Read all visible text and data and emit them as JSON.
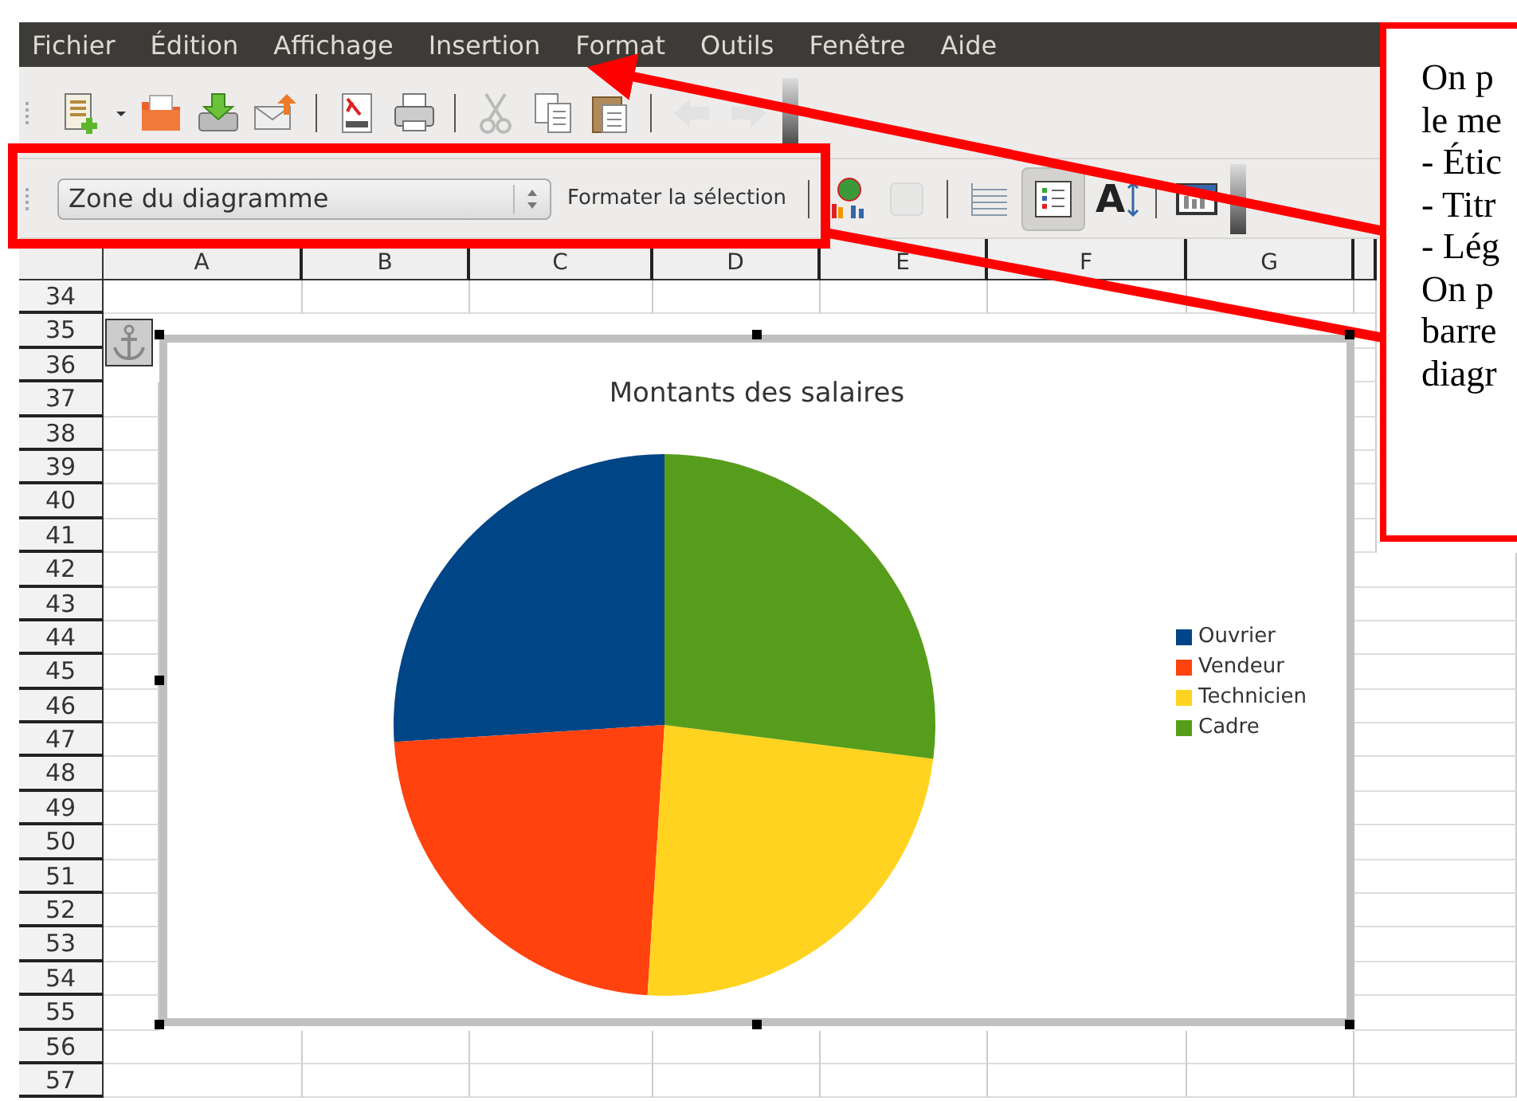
{
  "menu": [
    {
      "label": "Fichier"
    },
    {
      "label": "Édition"
    },
    {
      "label": "Affichage"
    },
    {
      "label": "Insertion"
    },
    {
      "label": "Format"
    },
    {
      "label": "Outils"
    },
    {
      "label": "Fenêtre"
    },
    {
      "label": "Aide"
    }
  ],
  "chart_toolbar": {
    "element_select": {
      "value": "Zone du diagramme"
    },
    "format_button": "Formater la sélection",
    "legend_on": true,
    "text_scale_glyph": "A"
  },
  "sheet": {
    "columns": [
      "A",
      "B",
      "C",
      "D",
      "E",
      "F",
      "G"
    ],
    "rows": [
      "34",
      "35",
      "36",
      "37",
      "38",
      "39",
      "40",
      "41",
      "42",
      "43",
      "44",
      "45",
      "46",
      "47",
      "48",
      "49",
      "50",
      "51",
      "52",
      "53",
      "54",
      "55",
      "56",
      "57"
    ]
  },
  "chart": {
    "title": "Montants des salaires",
    "legend": [
      {
        "label": "Ouvrier",
        "color": "#004586"
      },
      {
        "label": "Vendeur",
        "color": "#ff420e"
      },
      {
        "label": "Technicien",
        "color": "#ffd320"
      },
      {
        "label": "Cadre",
        "color": "#579d1c"
      }
    ]
  },
  "callout": {
    "lines": [
      "On p",
      "le me",
      "- Étic",
      "- Titr",
      "- Lég",
      "On p",
      "barre",
      "diagr"
    ]
  }
}
